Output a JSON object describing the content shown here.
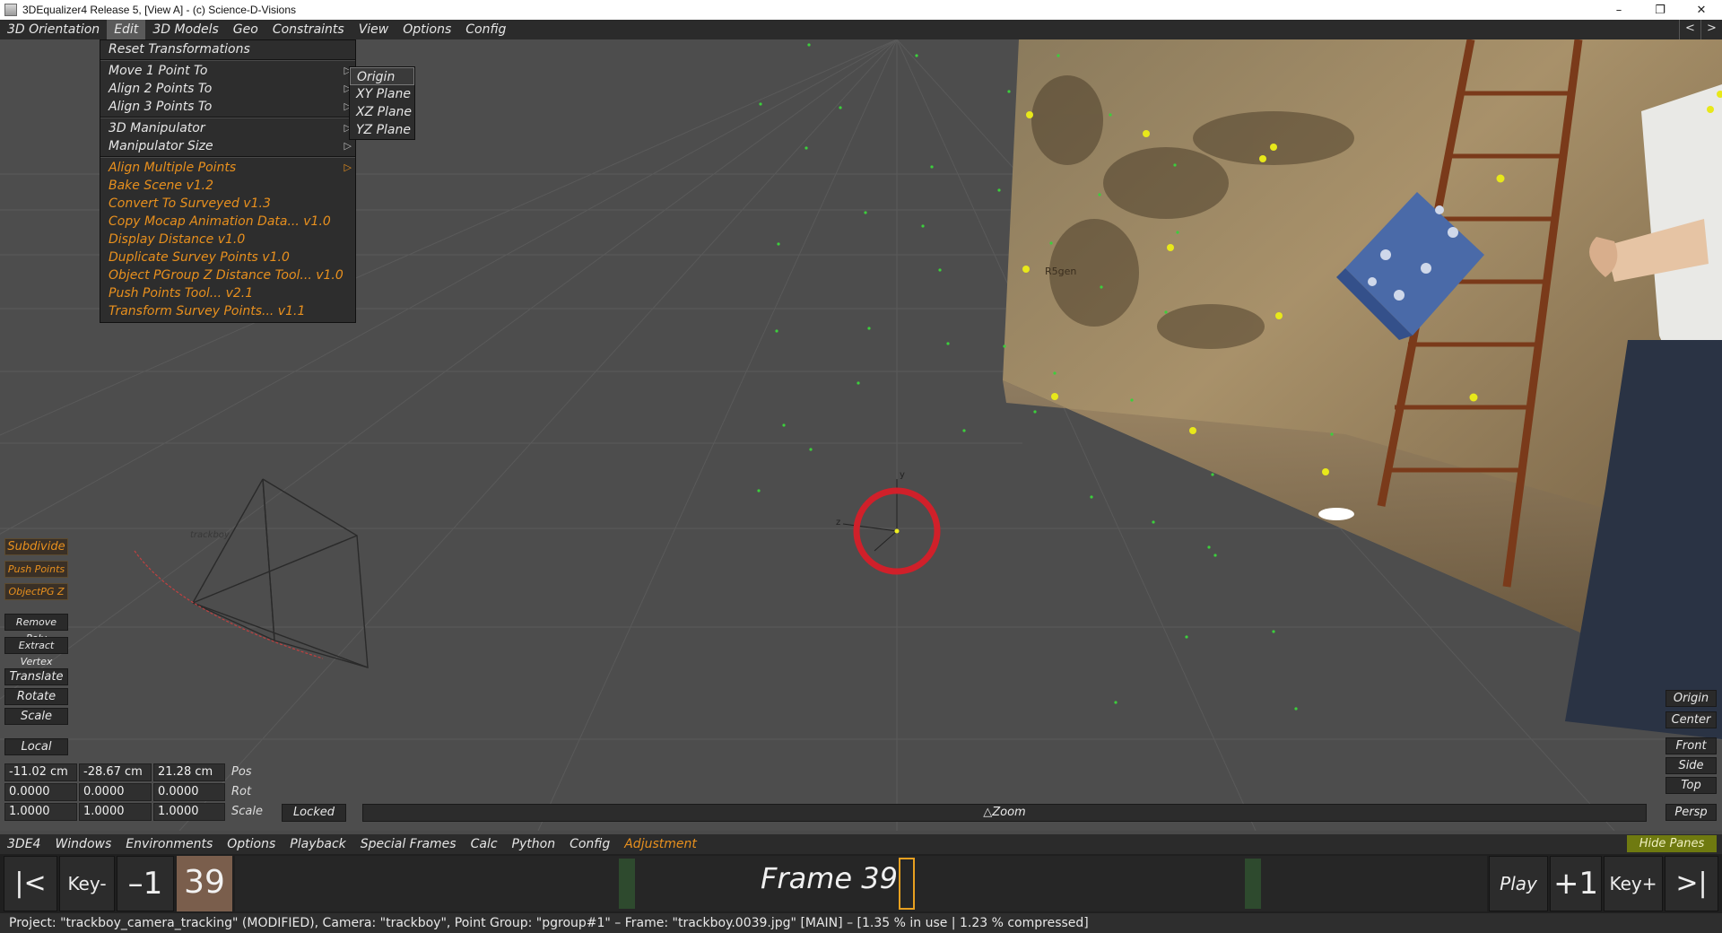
{
  "window": {
    "title": "3DEqualizer4 Release 5, [View A]  -  (c) Science-D-Visions",
    "controls": [
      "–",
      "❐",
      "✕"
    ]
  },
  "menubar": {
    "items": [
      "3D Orientation",
      "Edit",
      "3D Models",
      "Geo",
      "Constraints",
      "View",
      "Options",
      "Config"
    ],
    "active": "Edit",
    "nav": [
      "<",
      ">"
    ]
  },
  "edit_menu": {
    "items": [
      {
        "label": "Reset Transformations"
      },
      {
        "label": "Move 1 Point To"
      },
      {
        "label": "Align 2 Points To"
      },
      {
        "label": "Align 3 Points To"
      },
      {
        "label": "3D Manipulator"
      },
      {
        "label": "Manipulator Size"
      },
      {
        "label": "Align Multiple Points"
      },
      {
        "label": "Bake Scene  v1.2"
      },
      {
        "label": "Convert To Surveyed  v1.3"
      },
      {
        "label": "Copy Mocap Animation Data...  v1.0"
      },
      {
        "label": "Display Distance  v1.0"
      },
      {
        "label": "Duplicate Survey Points  v1.0"
      },
      {
        "label": "Object PGroup Z Distance Tool...  v1.0"
      },
      {
        "label": "Push Points Tool...  v2.1"
      },
      {
        "label": "Transform Survey Points...  v1.1"
      }
    ],
    "arrow_glyph": "▷"
  },
  "submenu": {
    "items": [
      "Origin",
      "XY Plane",
      "XZ Plane",
      "YZ Plane"
    ],
    "selected": "Origin"
  },
  "viewport": {
    "camera_label": "trackboy",
    "wall_text": "R5gen",
    "axis_labels": {
      "y": "y",
      "z": "z"
    }
  },
  "left_tools": {
    "subdivide": "Subdivide",
    "push_points": "Push Points",
    "objectpg_z": "ObjectPG Z",
    "remove_poly": "Remove Poly",
    "extract_vertex": "Extract Vertex",
    "translate": "Translate",
    "rotate": "Rotate",
    "scale": "Scale",
    "local": "Local"
  },
  "transform": {
    "pos": [
      "-11.02 cm",
      "-28.67 cm",
      "21.28 cm"
    ],
    "rot": [
      "0.0000",
      "0.0000",
      "0.0000"
    ],
    "scale": [
      "1.0000",
      "1.0000",
      "1.0000"
    ],
    "labels": {
      "pos": "Pos",
      "rot": "Rot",
      "scale": "Scale"
    },
    "locked": "Locked"
  },
  "zoom": {
    "label": "△Zoom"
  },
  "right_tools": {
    "origin": "Origin",
    "center": "Center",
    "front": "Front",
    "side": "Side",
    "top": "Top",
    "persp": "Persp"
  },
  "bottom_menu": {
    "items": [
      "3DE4",
      "Windows",
      "Environments",
      "Options",
      "Playback",
      "Special Frames",
      "Calc",
      "Python",
      "Config",
      "Adjustment"
    ],
    "hide_panes": "Hide Panes"
  },
  "timeline": {
    "first": "|<",
    "key_prev": "Key-",
    "minus_one": "–1",
    "current_frame": "39",
    "frame_label": "Frame 39",
    "play": "Play >",
    "plus_one": "+1",
    "key_next": "Key+",
    "last": ">|"
  },
  "status": {
    "text": "Project: \"trackboy_camera_tracking\"  (MODIFIED), Camera: \"trackboy\", Point Group: \"pgroup#1\"  –  Frame: \"trackboy.0039.jpg\"  [MAIN]  –  [1.35 % in use | 1.23 % compressed]"
  },
  "colors": {
    "accent_orange": "#e8901e",
    "track_point_green": "#3ccf3c",
    "survey_point_yellow": "#e8e81a",
    "highlight_red": "#d0202a"
  }
}
